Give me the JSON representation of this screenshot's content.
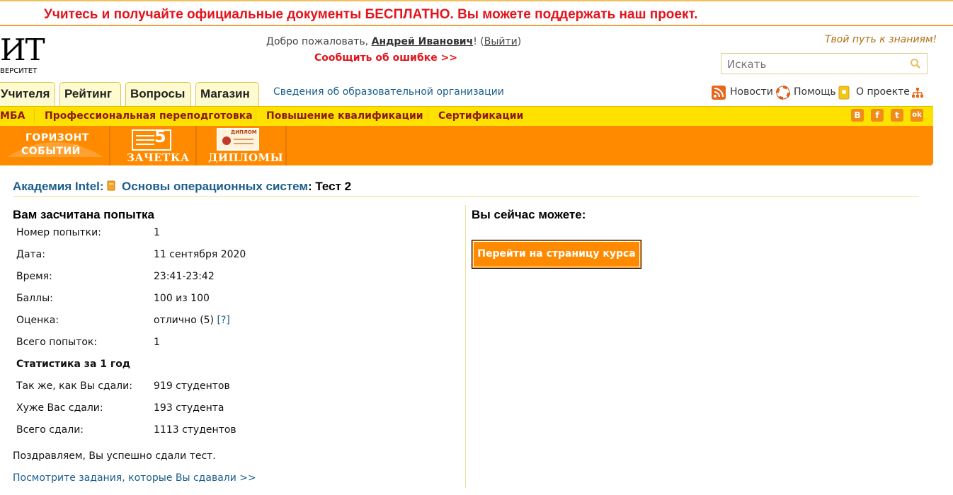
{
  "promo": {
    "text": "Учитесь и получайте официальные документы БЕСПЛАТНО. Вы можете поддержать наш проект."
  },
  "logo": {
    "big": "ИТ",
    "small": "ВЕРСИТЕТ"
  },
  "header": {
    "welcome_prefix": "Добро пожаловать, ",
    "user_name": "Андрей Иванович",
    "welcome_suffix": "! (",
    "logout": "Выйти",
    "welcome_end": ")",
    "report_error": "Сообщить об ошибке >>",
    "tagline": "Твой путь к знаниям!",
    "search_placeholder": "Искать"
  },
  "tabs": [
    "Учителя",
    "Рейтинг",
    "Вопросы",
    "Магазин"
  ],
  "org_info": "Сведения об образовательной организации",
  "top_links": {
    "news": "Новости",
    "help": "Помощь",
    "about": "О проекте"
  },
  "yellow_menu": [
    "МБА",
    "Профессиональная переподготовка",
    "Повышение квалификации",
    "Сертификации"
  ],
  "social": [
    "В",
    "f",
    "t",
    "ok"
  ],
  "orange_menu": {
    "horizon_line1": "ГОРИЗОНТ",
    "horizon_line2": "СОБЫТИЙ",
    "zachetka": "ЗАЧЕТКА",
    "zachetka_grade": "5",
    "diplomas": "ДИПЛОМЫ",
    "diploma_badge": "ДИПЛОМ"
  },
  "breadcrumb": {
    "academy": "Академия Intel",
    "course": "Основы операционных систем",
    "test": "Тест 2"
  },
  "result": {
    "heading": "Вам засчитана попытка",
    "rows": [
      {
        "label": "Номер попытки:",
        "value": "1"
      },
      {
        "label": "Дата:",
        "value": "11 сентября 2020"
      },
      {
        "label": "Время:",
        "value": "23:41-23:42"
      },
      {
        "label": "Баллы:",
        "value": "100 из 100"
      },
      {
        "label": "Оценка:",
        "value": "отлично (5)",
        "help": "[?]"
      },
      {
        "label": "Всего попыток:",
        "value": "1"
      }
    ],
    "stats_heading": "Статистика за 1 год",
    "stats": [
      {
        "label": "Так же, как Вы сдали:",
        "value": "919 студентов"
      },
      {
        "label": "Хуже Вас сдали:",
        "value": "193 студента"
      },
      {
        "label": "Всего сдали:",
        "value": "1113 студентов"
      }
    ],
    "congrats": "Поздравляем, Вы успешно сдали тест.",
    "view_tasks": "Посмотрите задания, которые Вы сдавали >>"
  },
  "actions": {
    "heading": "Вы сейчас можете:",
    "go_course": "Перейти на страницу курса"
  },
  "colors": {
    "accent_orange": "#ff8a00",
    "menu_yellow": "#ffe100",
    "link_blue": "#1a5e8c",
    "alert_red": "#e3141b"
  }
}
